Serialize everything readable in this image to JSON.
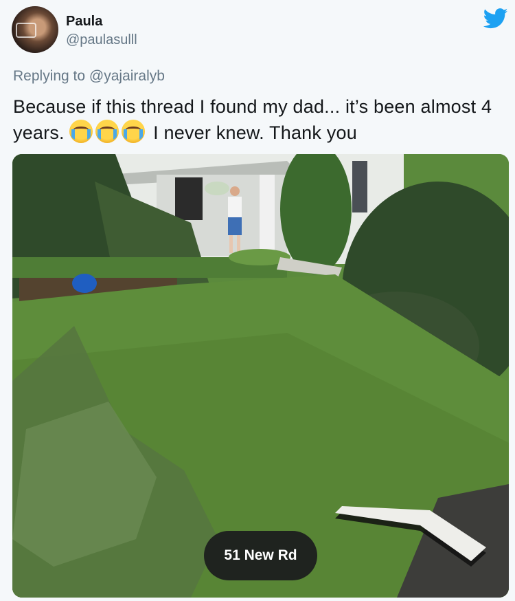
{
  "author": {
    "display_name": "Paula",
    "handle": "@paulasulll",
    "avatar_icon": "profile-photo"
  },
  "brand": {
    "icon": "twitter-bird-icon",
    "color": "#1da1f2"
  },
  "reply": {
    "prefix": "Replying to",
    "mention": "@yajairalyb"
  },
  "tweet": {
    "text_part1": "Because if this thread I found my dad... it’s been almost 4 years.",
    "emojis": [
      "loudly-crying-face",
      "loudly-crying-face",
      "loudly-crying-face"
    ],
    "text_part2": "I never knew. Thank you"
  },
  "media": {
    "type": "street-view-photo",
    "address_label": "51 New Rd",
    "nav_arrow_icon": "street-view-arrow-icon"
  }
}
